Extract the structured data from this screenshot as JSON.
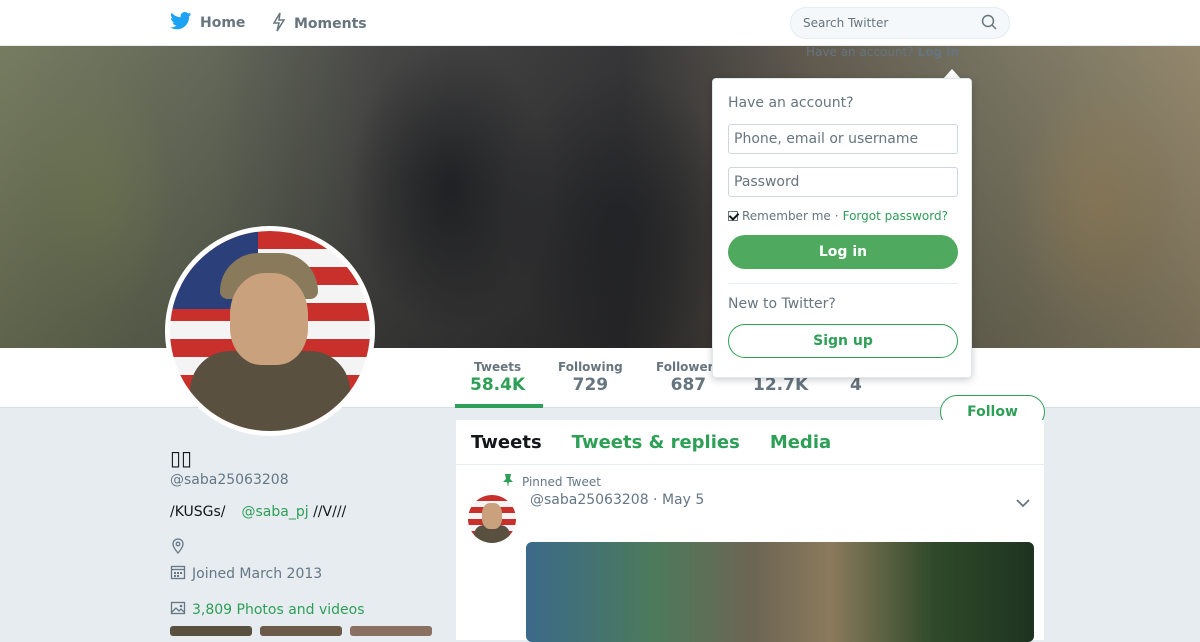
{
  "nav": {
    "home_label": "Home",
    "moments_label": "Moments",
    "search_placeholder": "Search Twitter",
    "home_icon": "bird-icon",
    "moments_icon": "lightning-icon",
    "search_icon": "magnifier-icon"
  },
  "login_hint": {
    "text": "Have an account?",
    "link": "Log in"
  },
  "stats": [
    {
      "label": "Tweets",
      "value": "58.4K"
    },
    {
      "label": "Following",
      "value": "729"
    },
    {
      "label": "Followers",
      "value": "687"
    },
    {
      "label": "",
      "value": "12.7K"
    },
    {
      "label": "",
      "value": "4"
    }
  ],
  "follow_label": "Follow",
  "profile": {
    "name": "▯▯",
    "handle": "@saba25063208",
    "bio_text": "/KUSGs/",
    "bio_mention": "@saba_pj",
    "bio_suffix": " //V///",
    "joined": "Joined March 2013",
    "media_link": "3,809 Photos and videos"
  },
  "timeline": {
    "tabs": [
      "Tweets",
      "Tweets & replies",
      "Media"
    ],
    "pinned_label": "Pinned Tweet",
    "tweet_header": "@saba25063208 · May 5"
  },
  "popover": {
    "title": "Have an account?",
    "username_placeholder": "Phone, email or username",
    "password_placeholder": "Password",
    "remember": "Remember me",
    "separator": "·",
    "forgot": "Forgot password?",
    "login_button": "Log in",
    "new_title": "New to Twitter?",
    "signup_button": "Sign up"
  },
  "colors": {
    "accent": "#2e9f56",
    "login_button": "#4faa5f",
    "text_muted": "#66757f"
  }
}
